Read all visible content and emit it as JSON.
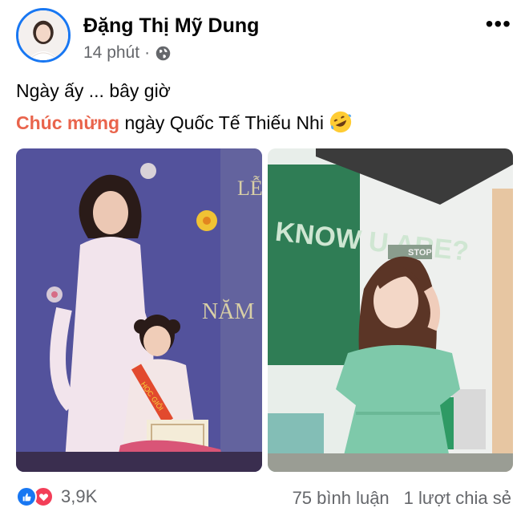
{
  "post": {
    "author": "Đặng Thị Mỹ Dung",
    "time": "14 phút",
    "privacy_icon": "globe-icon",
    "more_label": "•••",
    "text_line1": "Ngày ấy ... bây giờ",
    "highlight": "Chúc mừng",
    "text_line2_rest": "ngày Quốc Tế Thiếu Nhi",
    "emoji": "rofl-emoji",
    "photos": [
      {
        "description_icon": "photo-then"
      },
      {
        "description_icon": "photo-now"
      }
    ]
  },
  "photo_signs": {
    "left_text_top": "LỄ",
    "left_text_mid": "NĂM",
    "sash": "HỌC GIỎI",
    "board": "KNOW U ARE?",
    "stop": "STOP"
  },
  "engagement": {
    "reaction_icons": [
      "like-icon",
      "love-icon"
    ],
    "reaction_count": "3,9K",
    "comments": "75 bình luận",
    "shares": "1 lượt chia sẻ"
  },
  "colors": {
    "accent": "#1877f2",
    "highlight": "#e9644c",
    "secondary_text": "#65676b",
    "love": "#f33e58"
  }
}
